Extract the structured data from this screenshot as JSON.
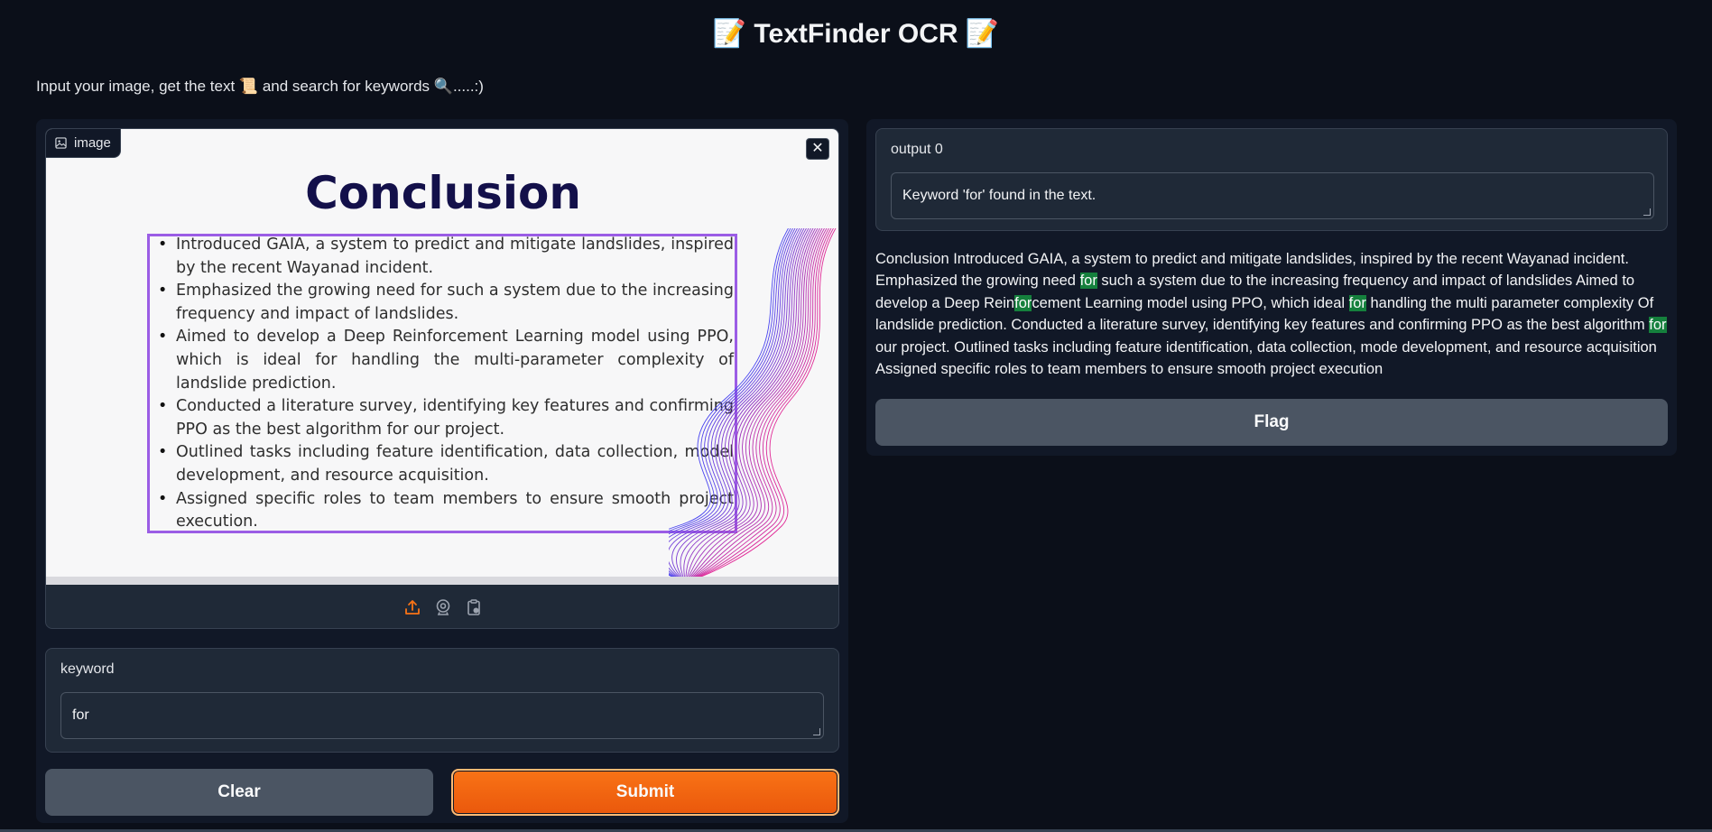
{
  "header": {
    "title": "TextFinder OCR",
    "emoji": "📝",
    "subtitle_prefix": "Input your image, get the text",
    "subtitle_scroll_emoji": "📜",
    "subtitle_middle": "and search for keywords",
    "subtitle_search_emoji": "🔍",
    "subtitle_suffix": ".....:)"
  },
  "image_input": {
    "label": "image",
    "close_symbol": "✕",
    "slide": {
      "title": "Conclusion",
      "bullets": [
        "Introduced GAIA, a system to predict and mitigate landslides, inspired by the recent Wayanad incident.",
        "Emphasized the growing need for such a system due to the increasing frequency and impact of landslides.",
        "Aimed to develop a Deep Reinforcement Learning model using PPO, which is ideal for handling the multi-parameter complexity of landslide prediction.",
        "Conducted a literature survey, identifying key features and confirming PPO as the best algorithm for our project.",
        "Outlined tasks including feature identification, data collection, model development, and resource acquisition.",
        "Assigned specific roles to team members to ensure smooth project execution."
      ]
    },
    "toolbar_icons": [
      "upload-icon",
      "webcam-icon",
      "clipboard-icon"
    ],
    "accent_color": "#f97316"
  },
  "keyword": {
    "label": "keyword",
    "value": "for"
  },
  "buttons": {
    "clear": "Clear",
    "submit": "Submit",
    "flag": "Flag"
  },
  "output": {
    "label": "output 0",
    "value": "Keyword 'for' found in the text.",
    "highlight_color": "#15803d",
    "result_segments": [
      {
        "text": "Conclusion Introduced GAIA, a system to predict and mitigate landslides, inspired by the recent Wayanad incident. Emphasized the growing need ",
        "hl": false
      },
      {
        "text": "for",
        "hl": true
      },
      {
        "text": " such a system due to the increasing frequency and impact of landslides Aimed to develop a Deep Rein",
        "hl": false
      },
      {
        "text": "for",
        "hl": true
      },
      {
        "text": "cement Learning model using PPO, which ideal ",
        "hl": false
      },
      {
        "text": "for",
        "hl": true
      },
      {
        "text": " handling the multi parameter complexity Of landslide prediction. Conducted a literature survey, identifying key features and confirming PPO as the best algorithm ",
        "hl": false
      },
      {
        "text": "for",
        "hl": true
      },
      {
        "text": " our project. Outlined tasks including feature identification, data collection, mode development, and resource acquisition Assigned specific roles to team members to ensure smooth project execution",
        "hl": false
      }
    ]
  }
}
